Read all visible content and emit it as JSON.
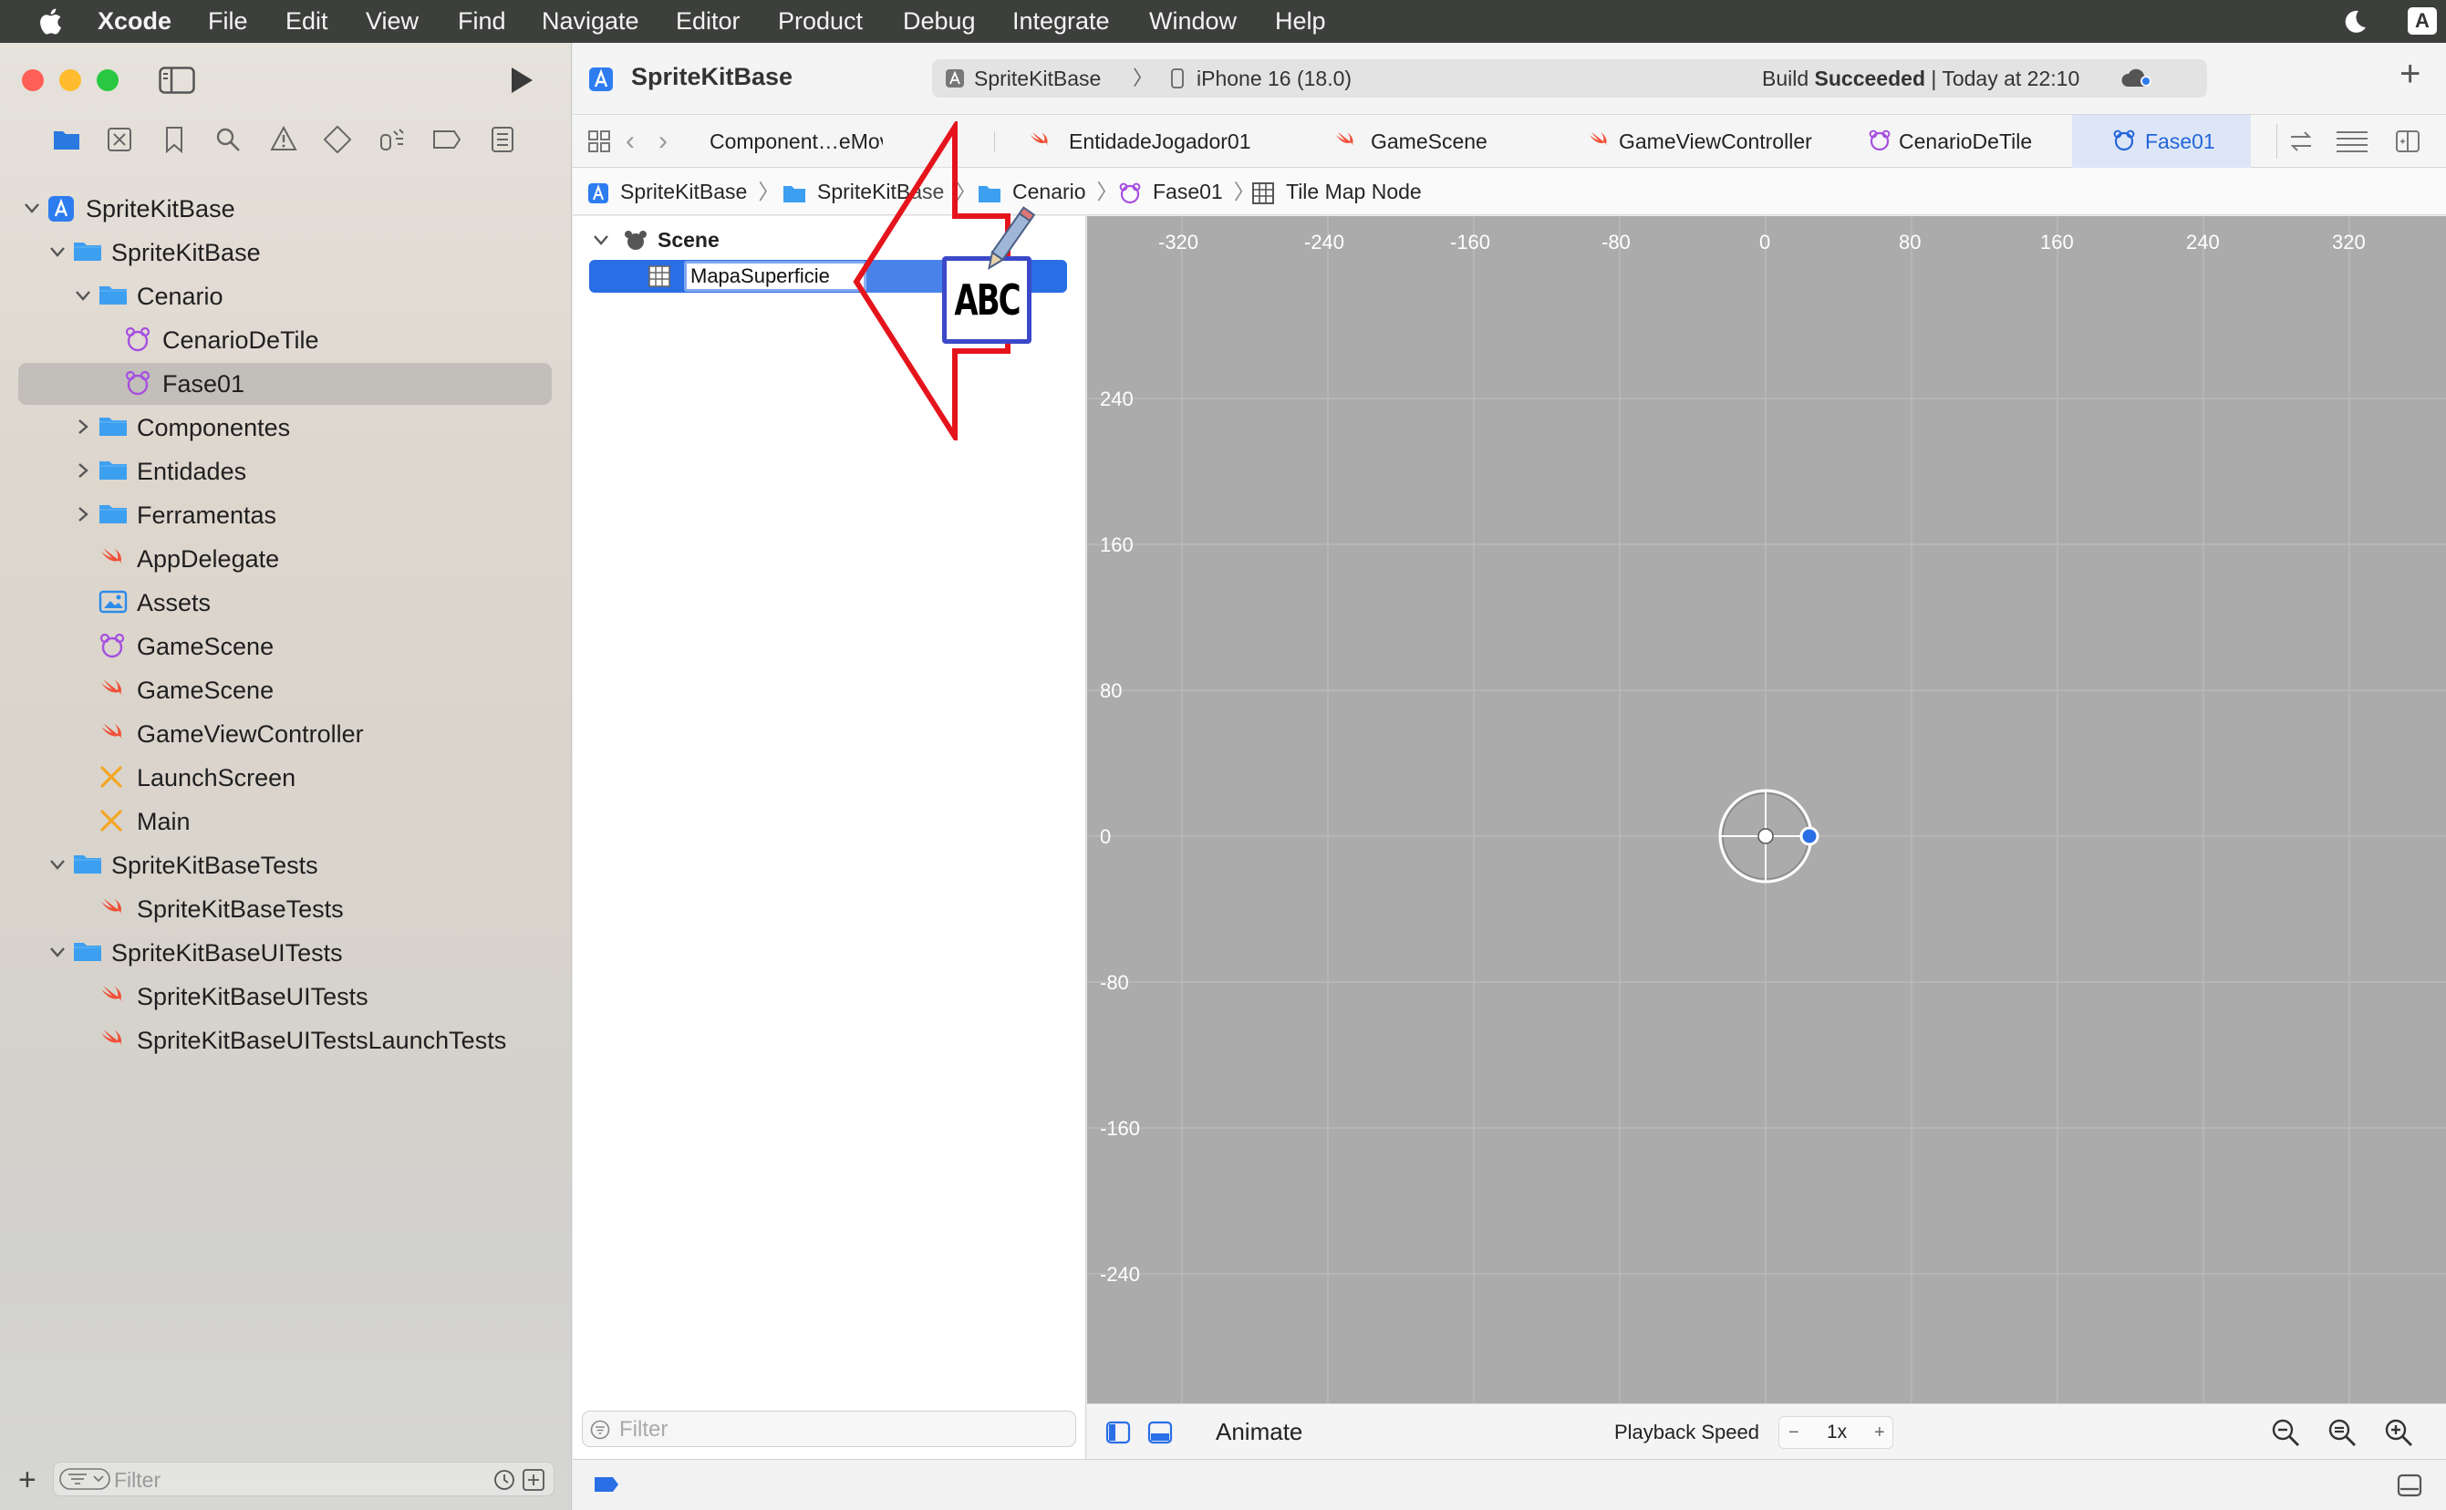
{
  "menubar": {
    "items": [
      "Xcode",
      "File",
      "Edit",
      "View",
      "Find",
      "Navigate",
      "Editor",
      "Product",
      "Debug",
      "Integrate",
      "Window",
      "Help"
    ],
    "right_badge": "A"
  },
  "toolbar": {
    "project_name": "SpriteKitBase",
    "scheme": "SpriteKitBase",
    "device": "iPhone 16 (18.0)",
    "status_prefix": "Build ",
    "status_bold": "Succeeded",
    "status_suffix": " | Today at 22:10"
  },
  "navigator": {
    "items": [
      {
        "label": "SpriteKitBase",
        "icon": "xcode-project-icon",
        "level": 0,
        "disclosure": "open"
      },
      {
        "label": "SpriteKitBase",
        "icon": "folder-icon",
        "level": 1,
        "disclosure": "open"
      },
      {
        "label": "Cenario",
        "icon": "folder-icon",
        "level": 2,
        "disclosure": "open"
      },
      {
        "label": "CenarioDeTile",
        "icon": "spritekit-scene-icon",
        "level": 3,
        "disclosure": "none"
      },
      {
        "label": "Fase01",
        "icon": "spritekit-scene-icon",
        "level": 3,
        "disclosure": "none",
        "selected": true
      },
      {
        "label": "Componentes",
        "icon": "folder-icon",
        "level": 2,
        "disclosure": "closed"
      },
      {
        "label": "Entidades",
        "icon": "folder-icon",
        "level": 2,
        "disclosure": "closed"
      },
      {
        "label": "Ferramentas",
        "icon": "folder-icon",
        "level": 2,
        "disclosure": "closed"
      },
      {
        "label": "AppDelegate",
        "icon": "swift-file-icon",
        "level": 2,
        "disclosure": "none"
      },
      {
        "label": "Assets",
        "icon": "asset-catalog-icon",
        "level": 2,
        "disclosure": "none"
      },
      {
        "label": "GameScene",
        "icon": "spritekit-scene-icon",
        "level": 2,
        "disclosure": "none"
      },
      {
        "label": "GameScene",
        "icon": "swift-file-icon",
        "level": 2,
        "disclosure": "none"
      },
      {
        "label": "GameViewController",
        "icon": "swift-file-icon",
        "level": 2,
        "disclosure": "none"
      },
      {
        "label": "LaunchScreen",
        "icon": "storyboard-icon",
        "level": 2,
        "disclosure": "none"
      },
      {
        "label": "Main",
        "icon": "storyboard-icon",
        "level": 2,
        "disclosure": "none"
      },
      {
        "label": "SpriteKitBaseTests",
        "icon": "folder-icon",
        "level": 1,
        "disclosure": "open"
      },
      {
        "label": "SpriteKitBaseTests",
        "icon": "swift-file-icon",
        "level": 2,
        "disclosure": "none"
      },
      {
        "label": "SpriteKitBaseUITests",
        "icon": "folder-icon",
        "level": 1,
        "disclosure": "open"
      },
      {
        "label": "SpriteKitBaseUITests",
        "icon": "swift-file-icon",
        "level": 2,
        "disclosure": "none"
      },
      {
        "label": "SpriteKitBaseUITestsLaunchTests",
        "icon": "swift-file-icon",
        "level": 2,
        "disclosure": "none"
      }
    ],
    "filter_placeholder": "Filter"
  },
  "tabs": [
    {
      "label": "Component…eMovimento",
      "icon": "none"
    },
    {
      "label": "EntidadeJogador01",
      "icon": "swift-file-icon"
    },
    {
      "label": "GameScene",
      "icon": "swift-file-icon"
    },
    {
      "label": "GameViewController",
      "icon": "swift-file-icon"
    },
    {
      "label": "CenarioDeTile",
      "icon": "spritekit-scene-icon"
    },
    {
      "label": "Fase01",
      "icon": "spritekit-scene-icon",
      "active": true
    }
  ],
  "jumpbar": [
    "SpriteKitBase",
    "SpriteKitBase",
    "Cenario",
    "Fase01",
    "Tile Map Node"
  ],
  "outline": {
    "root": "Scene",
    "selected_node": "MapaSuperficie",
    "filter_placeholder": "Filter"
  },
  "annotation": {
    "badge_text": "ABC"
  },
  "canvas": {
    "x_ruler": [
      "-320",
      "-240",
      "-160",
      "-80",
      "0",
      "80",
      "160",
      "240",
      "320"
    ],
    "y_ruler": [
      "240",
      "160",
      "80",
      "0",
      "-80",
      "-160",
      "-240"
    ]
  },
  "bottombar": {
    "animate_label": "Animate",
    "playback_label": "Playback Speed",
    "minus": "−",
    "speed": "1x",
    "plus": "+"
  },
  "colors": {
    "accent": "#2466d8",
    "folder": "#3d9ff0",
    "swift": "#f05138",
    "spritekit": "#a64fe0",
    "storyboard": "#f5a623",
    "annotation_red": "#e5141c",
    "canvas_bg": "#ababab"
  }
}
